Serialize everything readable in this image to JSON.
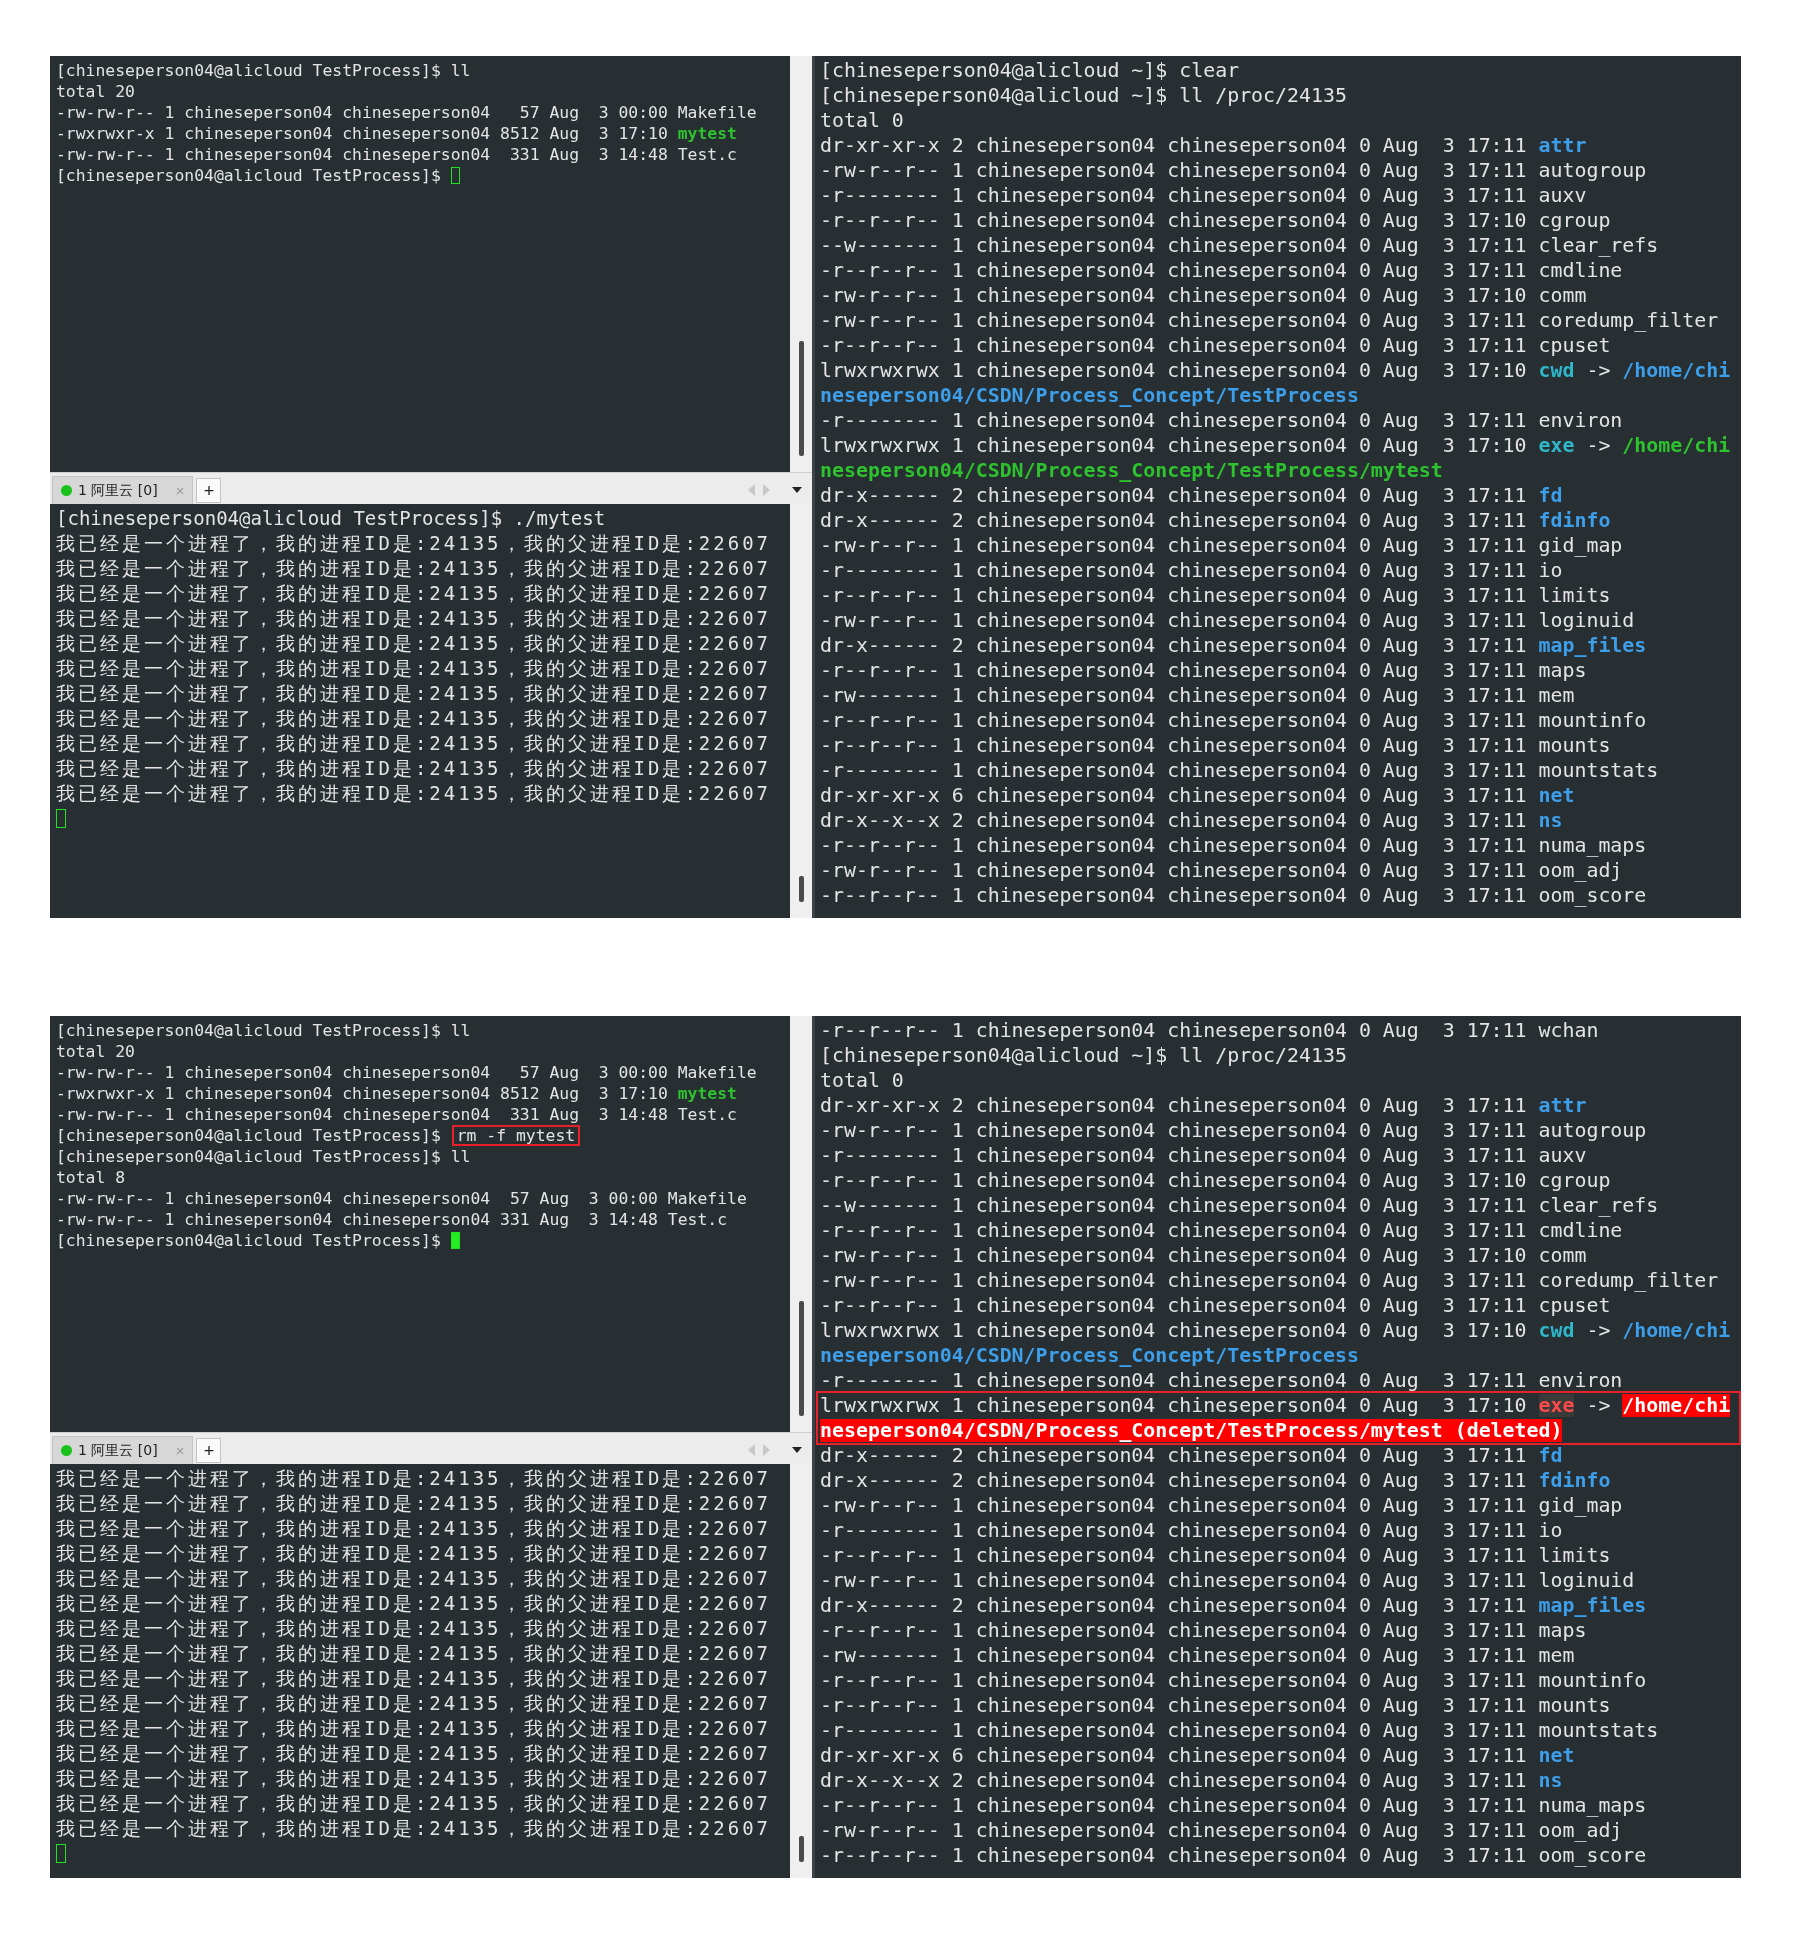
{
  "groups": [
    {
      "left": {
        "upper": {
          "lines": [
            "[chineseperson04@alicloud TestProcess]$ ll",
            "total 20",
            "-rw-rw-r-- 1 chineseperson04 chineseperson04   57 Aug  3 00:00 Makefile",
            [
              "-rwxrwxr-x 1 chineseperson04 chineseperson04 8512 Aug  3 17:10 ",
              {
                "text": "mytest",
                "kind": "exec"
              }
            ],
            "-rw-rw-r-- 1 chineseperson04 chineseperson04  331 Aug  3 14:48 Test.c",
            [
              "[chineseperson04@alicloud TestProcess]$ ",
              {
                "kind": "cursor",
                "focused": false
              }
            ]
          ]
        },
        "tab_bar": {
          "tabs": [
            {
              "label": "1 阿里云 [0]",
              "selected": true,
              "connected": true,
              "close": "×"
            }
          ],
          "new_tab": "+"
        },
        "lower": {
          "lines": [
            "[chineseperson04@alicloud TestProcess]$ ./mytest",
            "我已经是一个进程了，我的进程ID是:24135，我的父进程ID是:22607",
            "我已经是一个进程了，我的进程ID是:24135，我的父进程ID是:22607",
            "我已经是一个进程了，我的进程ID是:24135，我的父进程ID是:22607",
            "我已经是一个进程了，我的进程ID是:24135，我的父进程ID是:22607",
            "我已经是一个进程了，我的进程ID是:24135，我的父进程ID是:22607",
            "我已经是一个进程了，我的进程ID是:24135，我的父进程ID是:22607",
            "我已经是一个进程了，我的进程ID是:24135，我的父进程ID是:22607",
            "我已经是一个进程了，我的进程ID是:24135，我的父进程ID是:22607",
            "我已经是一个进程了，我的进程ID是:24135，我的父进程ID是:22607",
            "我已经是一个进程了，我的进程ID是:24135，我的父进程ID是:22607",
            "我已经是一个进程了，我的进程ID是:24135，我的父进程ID是:22607",
            [
              {
                "kind": "cursor",
                "focused": false
              }
            ]
          ]
        }
      },
      "right": {
        "lines": [
          "[chineseperson04@alicloud ~]$ clear",
          "[chineseperson04@alicloud ~]$ ll /proc/24135",
          "total 0",
          [
            "dr-xr-xr-x 2 chineseperson04 chineseperson04 0 Aug  3 17:11 ",
            {
              "text": "attr",
              "kind": "dir"
            }
          ],
          "-rw-r--r-- 1 chineseperson04 chineseperson04 0 Aug  3 17:11 autogroup",
          "-r-------- 1 chineseperson04 chineseperson04 0 Aug  3 17:11 auxv",
          "-r--r--r-- 1 chineseperson04 chineseperson04 0 Aug  3 17:10 cgroup",
          "--w------- 1 chineseperson04 chineseperson04 0 Aug  3 17:11 clear_refs",
          "-r--r--r-- 1 chineseperson04 chineseperson04 0 Aug  3 17:11 cmdline",
          "-rw-r--r-- 1 chineseperson04 chineseperson04 0 Aug  3 17:10 comm",
          "-rw-r--r-- 1 chineseperson04 chineseperson04 0 Aug  3 17:11 coredump_filter",
          "-r--r--r-- 1 chineseperson04 chineseperson04 0 Aug  3 17:11 cpuset",
          [
            "lrwxrwxrwx 1 chineseperson04 chineseperson04 0 Aug  3 17:10 ",
            {
              "text": "cwd",
              "kind": "link"
            },
            " -> ",
            {
              "text": "/home/chi",
              "kind": "dir"
            }
          ],
          [
            {
              "text": "neseperson04/CSDN/Process_Concept/TestProcess",
              "kind": "dir"
            }
          ],
          "-r-------- 1 chineseperson04 chineseperson04 0 Aug  3 17:11 environ",
          [
            "lrwxrwxrwx 1 chineseperson04 chineseperson04 0 Aug  3 17:10 ",
            {
              "text": "exe",
              "kind": "link"
            },
            " -> ",
            {
              "text": "/home/chi",
              "kind": "exec"
            }
          ],
          [
            {
              "text": "neseperson04/CSDN/Process_Concept/TestProcess/mytest",
              "kind": "exec"
            }
          ],
          [
            "dr-x------ 2 chineseperson04 chineseperson04 0 Aug  3 17:11 ",
            {
              "text": "fd",
              "kind": "dir"
            }
          ],
          [
            "dr-x------ 2 chineseperson04 chineseperson04 0 Aug  3 17:11 ",
            {
              "text": "fdinfo",
              "kind": "dir"
            }
          ],
          "-rw-r--r-- 1 chineseperson04 chineseperson04 0 Aug  3 17:11 gid_map",
          "-r-------- 1 chineseperson04 chineseperson04 0 Aug  3 17:11 io",
          "-r--r--r-- 1 chineseperson04 chineseperson04 0 Aug  3 17:11 limits",
          "-rw-r--r-- 1 chineseperson04 chineseperson04 0 Aug  3 17:11 loginuid",
          [
            "dr-x------ 2 chineseperson04 chineseperson04 0 Aug  3 17:11 ",
            {
              "text": "map_files",
              "kind": "dir"
            }
          ],
          "-r--r--r-- 1 chineseperson04 chineseperson04 0 Aug  3 17:11 maps",
          "-rw------- 1 chineseperson04 chineseperson04 0 Aug  3 17:11 mem",
          "-r--r--r-- 1 chineseperson04 chineseperson04 0 Aug  3 17:11 mountinfo",
          "-r--r--r-- 1 chineseperson04 chineseperson04 0 Aug  3 17:11 mounts",
          "-r-------- 1 chineseperson04 chineseperson04 0 Aug  3 17:11 mountstats",
          [
            "dr-xr-xr-x 6 chineseperson04 chineseperson04 0 Aug  3 17:11 ",
            {
              "text": "net",
              "kind": "dir"
            }
          ],
          [
            "dr-x--x--x 2 chineseperson04 chineseperson04 0 Aug  3 17:11 ",
            {
              "text": "ns",
              "kind": "dir"
            }
          ],
          "-r--r--r-- 1 chineseperson04 chineseperson04 0 Aug  3 17:11 numa_maps",
          "-rw-r--r-- 1 chineseperson04 chineseperson04 0 Aug  3 17:11 oom_adj",
          "-r--r--r-- 1 chineseperson04 chineseperson04 0 Aug  3 17:11 oom_score"
        ]
      }
    },
    {
      "left": {
        "upper": {
          "lines": [
            "[chineseperson04@alicloud TestProcess]$ ll",
            "total 20",
            "-rw-rw-r-- 1 chineseperson04 chineseperson04   57 Aug  3 00:00 Makefile",
            [
              "-rwxrwxr-x 1 chineseperson04 chineseperson04 8512 Aug  3 17:10 ",
              {
                "text": "mytest",
                "kind": "exec"
              }
            ],
            "-rw-rw-r-- 1 chineseperson04 chineseperson04  331 Aug  3 14:48 Test.c",
            [
              "[chineseperson04@alicloud TestProcess]$ ",
              {
                "text": "rm -f mytest",
                "kind": "highlight"
              }
            ],
            "[chineseperson04@alicloud TestProcess]$ ll",
            "total 8",
            "-rw-rw-r-- 1 chineseperson04 chineseperson04  57 Aug  3 00:00 Makefile",
            "-rw-rw-r-- 1 chineseperson04 chineseperson04 331 Aug  3 14:48 Test.c",
            [
              "[chineseperson04@alicloud TestProcess]$ ",
              {
                "kind": "cursor",
                "focused": true
              }
            ]
          ]
        },
        "tab_bar": {
          "tabs": [
            {
              "label": "1 阿里云 [0]",
              "selected": true,
              "connected": true,
              "close": "×"
            }
          ],
          "new_tab": "+"
        },
        "lower": {
          "lines": [
            "我已经是一个进程了，我的进程ID是:24135，我的父进程ID是:22607",
            "我已经是一个进程了，我的进程ID是:24135，我的父进程ID是:22607",
            "我已经是一个进程了，我的进程ID是:24135，我的父进程ID是:22607",
            "我已经是一个进程了，我的进程ID是:24135，我的父进程ID是:22607",
            "我已经是一个进程了，我的进程ID是:24135，我的父进程ID是:22607",
            "我已经是一个进程了，我的进程ID是:24135，我的父进程ID是:22607",
            "我已经是一个进程了，我的进程ID是:24135，我的父进程ID是:22607",
            "我已经是一个进程了，我的进程ID是:24135，我的父进程ID是:22607",
            "我已经是一个进程了，我的进程ID是:24135，我的父进程ID是:22607",
            "我已经是一个进程了，我的进程ID是:24135，我的父进程ID是:22607",
            "我已经是一个进程了，我的进程ID是:24135，我的父进程ID是:22607",
            "我已经是一个进程了，我的进程ID是:24135，我的父进程ID是:22607",
            "我已经是一个进程了，我的进程ID是:24135，我的父进程ID是:22607",
            "我已经是一个进程了，我的进程ID是:24135，我的父进程ID是:22607",
            "我已经是一个进程了，我的进程ID是:24135，我的父进程ID是:22607",
            [
              {
                "kind": "cursor",
                "focused": false
              }
            ]
          ]
        }
      },
      "right": {
        "lines": [
          "-r--r--r-- 1 chineseperson04 chineseperson04 0 Aug  3 17:11 wchan",
          "[chineseperson04@alicloud ~]$ ll /proc/24135",
          "total 0",
          [
            "dr-xr-xr-x 2 chineseperson04 chineseperson04 0 Aug  3 17:11 ",
            {
              "text": "attr",
              "kind": "dir"
            }
          ],
          "-rw-r--r-- 1 chineseperson04 chineseperson04 0 Aug  3 17:11 autogroup",
          "-r-------- 1 chineseperson04 chineseperson04 0 Aug  3 17:11 auxv",
          "-r--r--r-- 1 chineseperson04 chineseperson04 0 Aug  3 17:10 cgroup",
          "--w------- 1 chineseperson04 chineseperson04 0 Aug  3 17:11 clear_refs",
          "-r--r--r-- 1 chineseperson04 chineseperson04 0 Aug  3 17:11 cmdline",
          "-rw-r--r-- 1 chineseperson04 chineseperson04 0 Aug  3 17:10 comm",
          "-rw-r--r-- 1 chineseperson04 chineseperson04 0 Aug  3 17:11 coredump_filter",
          "-r--r--r-- 1 chineseperson04 chineseperson04 0 Aug  3 17:11 cpuset",
          [
            "lrwxrwxrwx 1 chineseperson04 chineseperson04 0 Aug  3 17:10 ",
            {
              "text": "cwd",
              "kind": "link"
            },
            " -> ",
            {
              "text": "/home/chi",
              "kind": "dir"
            }
          ],
          [
            {
              "text": "neseperson04/CSDN/Process_Concept/TestProcess",
              "kind": "dir"
            }
          ],
          "-r-------- 1 chineseperson04 chineseperson04 0 Aug  3 17:11 environ",
          {
            "kind": "annotation",
            "lines": [
              [
                "lrwxrwxrwx 1 chineseperson04 chineseperson04 0 Aug  3 17:10 ",
                {
                  "text": "exe",
                  "kind": "orphan"
                },
                " -> ",
                {
                  "text": "/home/chi",
                  "kind": "missing"
                }
              ],
              [
                {
                  "text": "neseperson04/CSDN/Process_Concept/TestProcess/mytest (deleted)",
                  "kind": "missing"
                }
              ]
            ]
          },
          [
            "dr-x------ 2 chineseperson04 chineseperson04 0 Aug  3 17:11 ",
            {
              "text": "fd",
              "kind": "dir"
            }
          ],
          [
            "dr-x------ 2 chineseperson04 chineseperson04 0 Aug  3 17:11 ",
            {
              "text": "fdinfo",
              "kind": "dir"
            }
          ],
          "-rw-r--r-- 1 chineseperson04 chineseperson04 0 Aug  3 17:11 gid_map",
          "-r-------- 1 chineseperson04 chineseperson04 0 Aug  3 17:11 io",
          "-r--r--r-- 1 chineseperson04 chineseperson04 0 Aug  3 17:11 limits",
          "-rw-r--r-- 1 chineseperson04 chineseperson04 0 Aug  3 17:11 loginuid",
          [
            "dr-x------ 2 chineseperson04 chineseperson04 0 Aug  3 17:11 ",
            {
              "text": "map_files",
              "kind": "dir"
            }
          ],
          "-r--r--r-- 1 chineseperson04 chineseperson04 0 Aug  3 17:11 maps",
          "-rw------- 1 chineseperson04 chineseperson04 0 Aug  3 17:11 mem",
          "-r--r--r-- 1 chineseperson04 chineseperson04 0 Aug  3 17:11 mountinfo",
          "-r--r--r-- 1 chineseperson04 chineseperson04 0 Aug  3 17:11 mounts",
          "-r-------- 1 chineseperson04 chineseperson04 0 Aug  3 17:11 mountstats",
          [
            "dr-xr-xr-x 6 chineseperson04 chineseperson04 0 Aug  3 17:11 ",
            {
              "text": "net",
              "kind": "dir"
            }
          ],
          [
            "dr-x--x--x 2 chineseperson04 chineseperson04 0 Aug  3 17:11 ",
            {
              "text": "ns",
              "kind": "dir"
            }
          ],
          "-r--r--r-- 1 chineseperson04 chineseperson04 0 Aug  3 17:11 numa_maps",
          "-rw-r--r-- 1 chineseperson04 chineseperson04 0 Aug  3 17:11 oom_adj",
          "-r--r--r-- 1 chineseperson04 chineseperson04 0 Aug  3 17:11 oom_score"
        ]
      }
    }
  ]
}
